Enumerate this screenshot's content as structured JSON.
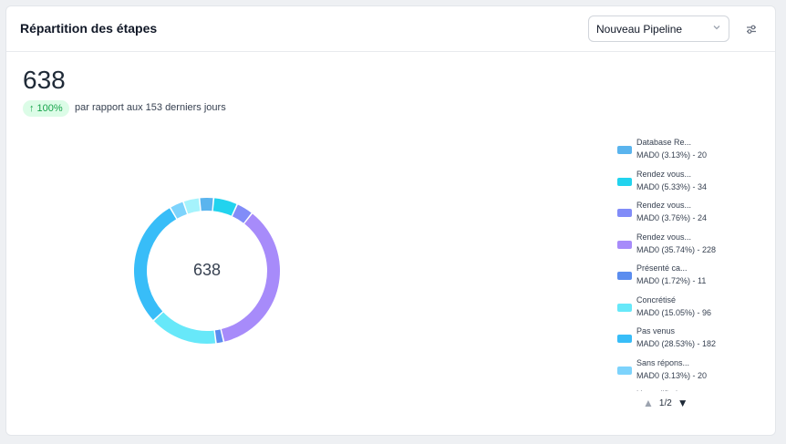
{
  "widget": {
    "title": "Répartition des étapes",
    "pipeline_select": "Nouveau Pipeline",
    "total": "638",
    "change_badge": "100%",
    "change_text": "par rapport aux 153 derniers jours",
    "center_value": "638"
  },
  "chart_data": {
    "type": "pie",
    "style": "donut",
    "total": 638,
    "slices": [
      {
        "name": "Database Re...",
        "detail": "MAD0 (3.13%) - 20",
        "value": 20,
        "color": "#5ab4ee"
      },
      {
        "name": "Rendez vous...",
        "detail": "MAD0 (5.33%) - 34",
        "value": 34,
        "color": "#22d3ee"
      },
      {
        "name": "Rendez vous...",
        "detail": "MAD0 (3.76%) - 24",
        "value": 24,
        "color": "#818cf8"
      },
      {
        "name": "Rendez vous...",
        "detail": "MAD0 (35.74%) - 228",
        "value": 228,
        "color": "#a78bfa"
      },
      {
        "name": "Présenté ca...",
        "detail": "MAD0 (1.72%) - 11",
        "value": 11,
        "color": "#5b8def"
      },
      {
        "name": "Concrétisé",
        "detail": "MAD0 (15.05%) - 96",
        "value": 96,
        "color": "#67e8f9"
      },
      {
        "name": "Pas venus",
        "detail": "MAD0 (28.53%) - 182",
        "value": 182,
        "color": "#38bdf8"
      },
      {
        "name": "Sans répons...",
        "detail": "MAD0 (3.13%) - 20",
        "value": 20,
        "color": "#7dd3fc"
      },
      {
        "name": "Unqualified",
        "detail": "",
        "value": 23,
        "color": "#a5f3fc"
      }
    ]
  },
  "legend_pager": {
    "page_label": "1/2"
  },
  "icons": {
    "select_chevron": "chevron-down-icon",
    "filter": "sliders-icon",
    "trend": "arrow-up-icon",
    "prev_page": "triangle-up-icon",
    "next_page": "triangle-down-icon"
  }
}
